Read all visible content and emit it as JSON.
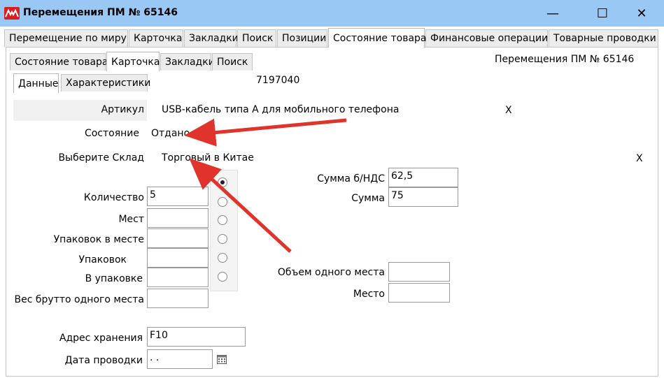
{
  "window": {
    "title": "Перемещения ПМ № 65146",
    "minimize_glyph": "—",
    "maximize_glyph": "☐",
    "close_glyph": "✕"
  },
  "outer_tabs": [
    "Перемещение по миру",
    "Карточка",
    "Закладки",
    "Поиск",
    "Позиции",
    "Состояние товара",
    "Финансовые операции",
    "Товарные проводки"
  ],
  "inner_tabs": [
    "Состояние товара",
    "Карточка",
    "Закладки",
    "Поиск"
  ],
  "sub_tabs": [
    "Данные",
    "Характеристики"
  ],
  "header_caption": "Перемещения ПМ № 65146",
  "code": "7197040",
  "fields": {
    "articul_label": "Артикул",
    "articul_value": "USB-кабель типа А для мобильного телефона",
    "articul_clear": "X",
    "state_label": "Состояние",
    "state_value": "Отдано",
    "warehouse_label": "Выберите Склад",
    "warehouse_value": "Торговый в Китае",
    "warehouse_clear": "X",
    "sum_nds_label": "Сумма  б/НДС",
    "sum_nds_value": "62,5",
    "sum_label": "Сумма",
    "sum_value": "75",
    "quantity_label": "Количество",
    "quantity_value": "5",
    "places_label": "Мест",
    "places_value": "",
    "packs_in_place_label": "Упаковок в месте",
    "packs_in_place_value": "",
    "packs_label": "Упаковок",
    "packs_value": "",
    "in_pack_label": "В упаковке",
    "in_pack_value": "",
    "gross_label": "Вес брутто одного места",
    "gross_value": "",
    "volume_label": "Объем одного места",
    "volume_value": "",
    "place_label": "Место",
    "place_value": "",
    "storage_label": "Адрес хранения",
    "storage_value": "F10",
    "date_label": "Дата проводки",
    "date_value": " .  ."
  },
  "colors": {
    "titlebar": "#99c8f5",
    "arrow": "#e0332b"
  },
  "icons": {
    "app": "app-logo-icon",
    "calendar": "calendar-icon"
  }
}
